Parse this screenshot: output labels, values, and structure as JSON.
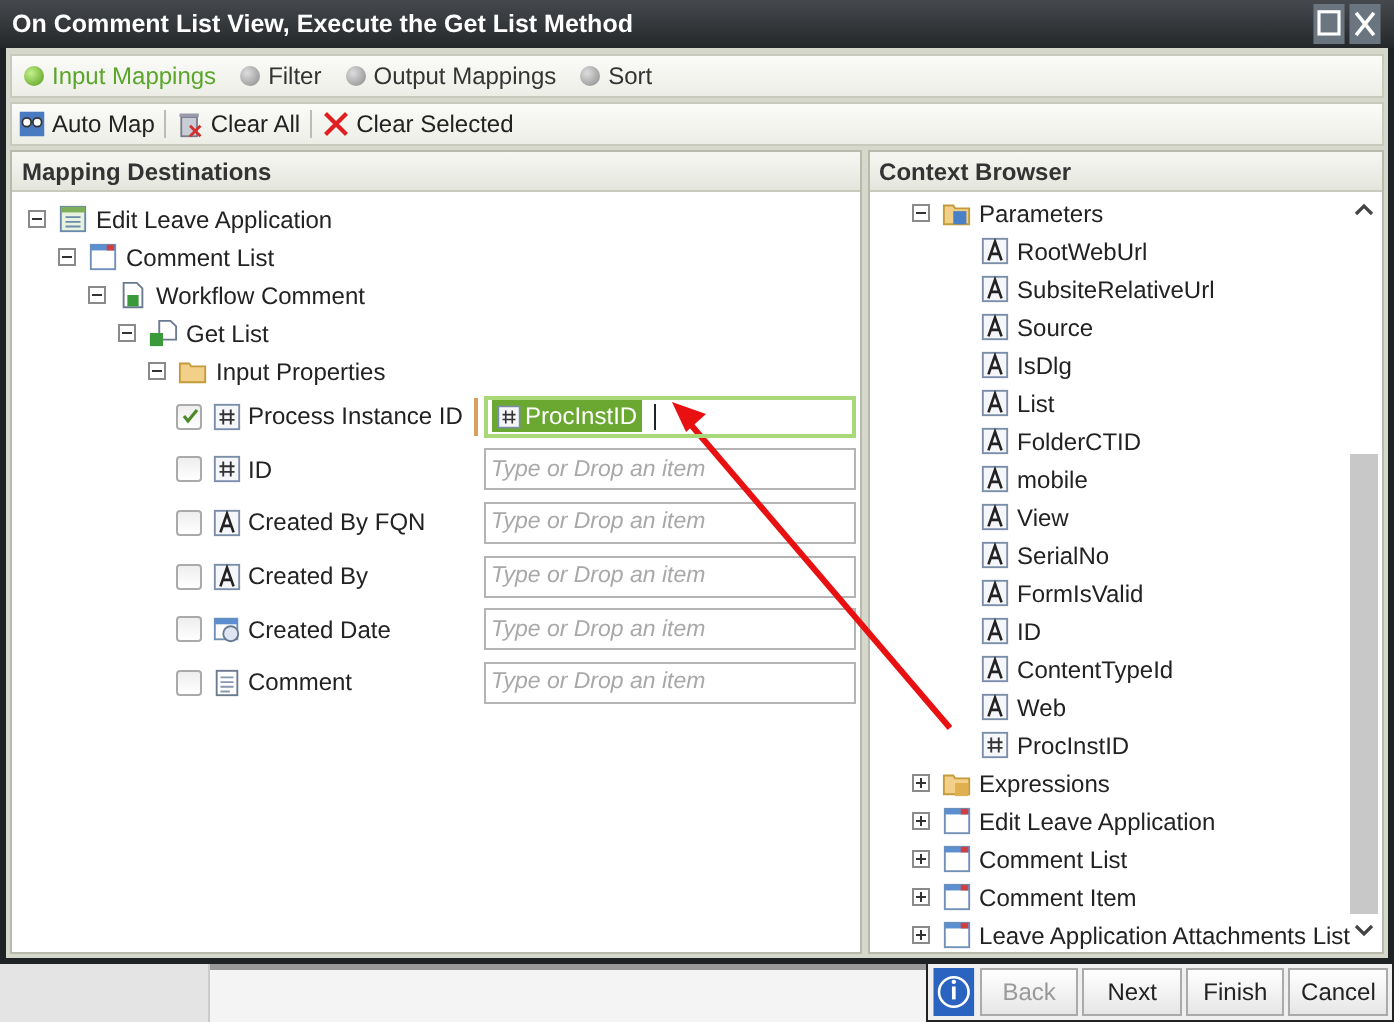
{
  "window": {
    "title": "On Comment List View, Execute the Get List Method"
  },
  "steps": [
    {
      "label": "Input Mappings",
      "selected": true
    },
    {
      "label": "Filter",
      "selected": false
    },
    {
      "label": "Output Mappings",
      "selected": false
    },
    {
      "label": "Sort",
      "selected": false
    }
  ],
  "toolbar": [
    {
      "label": "Auto Map",
      "kind": "automap"
    },
    {
      "label": "Clear All",
      "kind": "clear-all"
    },
    {
      "label": "Clear Selected",
      "kind": "clear-selected"
    }
  ],
  "mapping_destinations": {
    "title": "Mapping Destinations",
    "tree": [
      {
        "label": "Edit Leave Application",
        "kind": "form",
        "expanded": true,
        "children": [
          {
            "label": "Comment List",
            "kind": "list",
            "expanded": true,
            "children": [
              {
                "label": "Workflow Comment",
                "kind": "object",
                "expanded": true,
                "children": [
                  {
                    "label": "Get List",
                    "kind": "method",
                    "expanded": true,
                    "children": [
                      {
                        "label": "Input Properties",
                        "kind": "folder",
                        "expanded": true,
                        "children": [
                          {
                            "kind": "number-property",
                            "label": "Process Instance ID",
                            "checked": true,
                            "value": "ProcInstID"
                          },
                          {
                            "kind": "number-property",
                            "label": "ID",
                            "checked": false,
                            "placeholder": "Type or Drop an item"
                          },
                          {
                            "kind": "text-property",
                            "label": "Created By FQN",
                            "checked": false,
                            "placeholder": "Type or Drop an item"
                          },
                          {
                            "kind": "text-property",
                            "label": "Created By",
                            "checked": false,
                            "placeholder": "Type or Drop an item"
                          },
                          {
                            "kind": "date-property",
                            "label": "Created Date",
                            "checked": false,
                            "placeholder": "Type or Drop an item"
                          },
                          {
                            "kind": "note-property",
                            "label": "Comment",
                            "checked": false,
                            "placeholder": "Type or Drop an item"
                          }
                        ]
                      }
                    ]
                  }
                ]
              }
            ]
          }
        ]
      }
    ]
  },
  "context_browser": {
    "title": "Context Browser",
    "tree": [
      {
        "label": "Parameters",
        "kind": "params",
        "expanded": true,
        "children": [
          {
            "label": "RootWebUrl",
            "kind": "text"
          },
          {
            "label": "SubsiteRelativeUrl",
            "kind": "text"
          },
          {
            "label": "Source",
            "kind": "text"
          },
          {
            "label": "IsDlg",
            "kind": "text"
          },
          {
            "label": "List",
            "kind": "text"
          },
          {
            "label": "FolderCTID",
            "kind": "text"
          },
          {
            "label": "mobile",
            "kind": "text"
          },
          {
            "label": "View",
            "kind": "text"
          },
          {
            "label": "SerialNo",
            "kind": "text"
          },
          {
            "label": "FormIsValid",
            "kind": "text"
          },
          {
            "label": "ID",
            "kind": "text"
          },
          {
            "label": "ContentTypeId",
            "kind": "text"
          },
          {
            "label": "Web",
            "kind": "text"
          },
          {
            "label": "ProcInstID",
            "kind": "number"
          }
        ]
      },
      {
        "label": "Expressions",
        "kind": "expressions",
        "expanded": false
      },
      {
        "label": "Edit Leave Application",
        "kind": "list",
        "expanded": false
      },
      {
        "label": "Comment List",
        "kind": "list",
        "expanded": false
      },
      {
        "label": "Comment Item",
        "kind": "list",
        "expanded": false
      },
      {
        "label": "Leave Application Attachments List",
        "kind": "list",
        "expanded": false
      }
    ]
  },
  "buttons": [
    {
      "label": "Back",
      "disabled": true
    },
    {
      "label": "Next",
      "disabled": false
    },
    {
      "label": "Finish",
      "disabled": false
    },
    {
      "label": "Cancel",
      "disabled": false
    }
  ]
}
